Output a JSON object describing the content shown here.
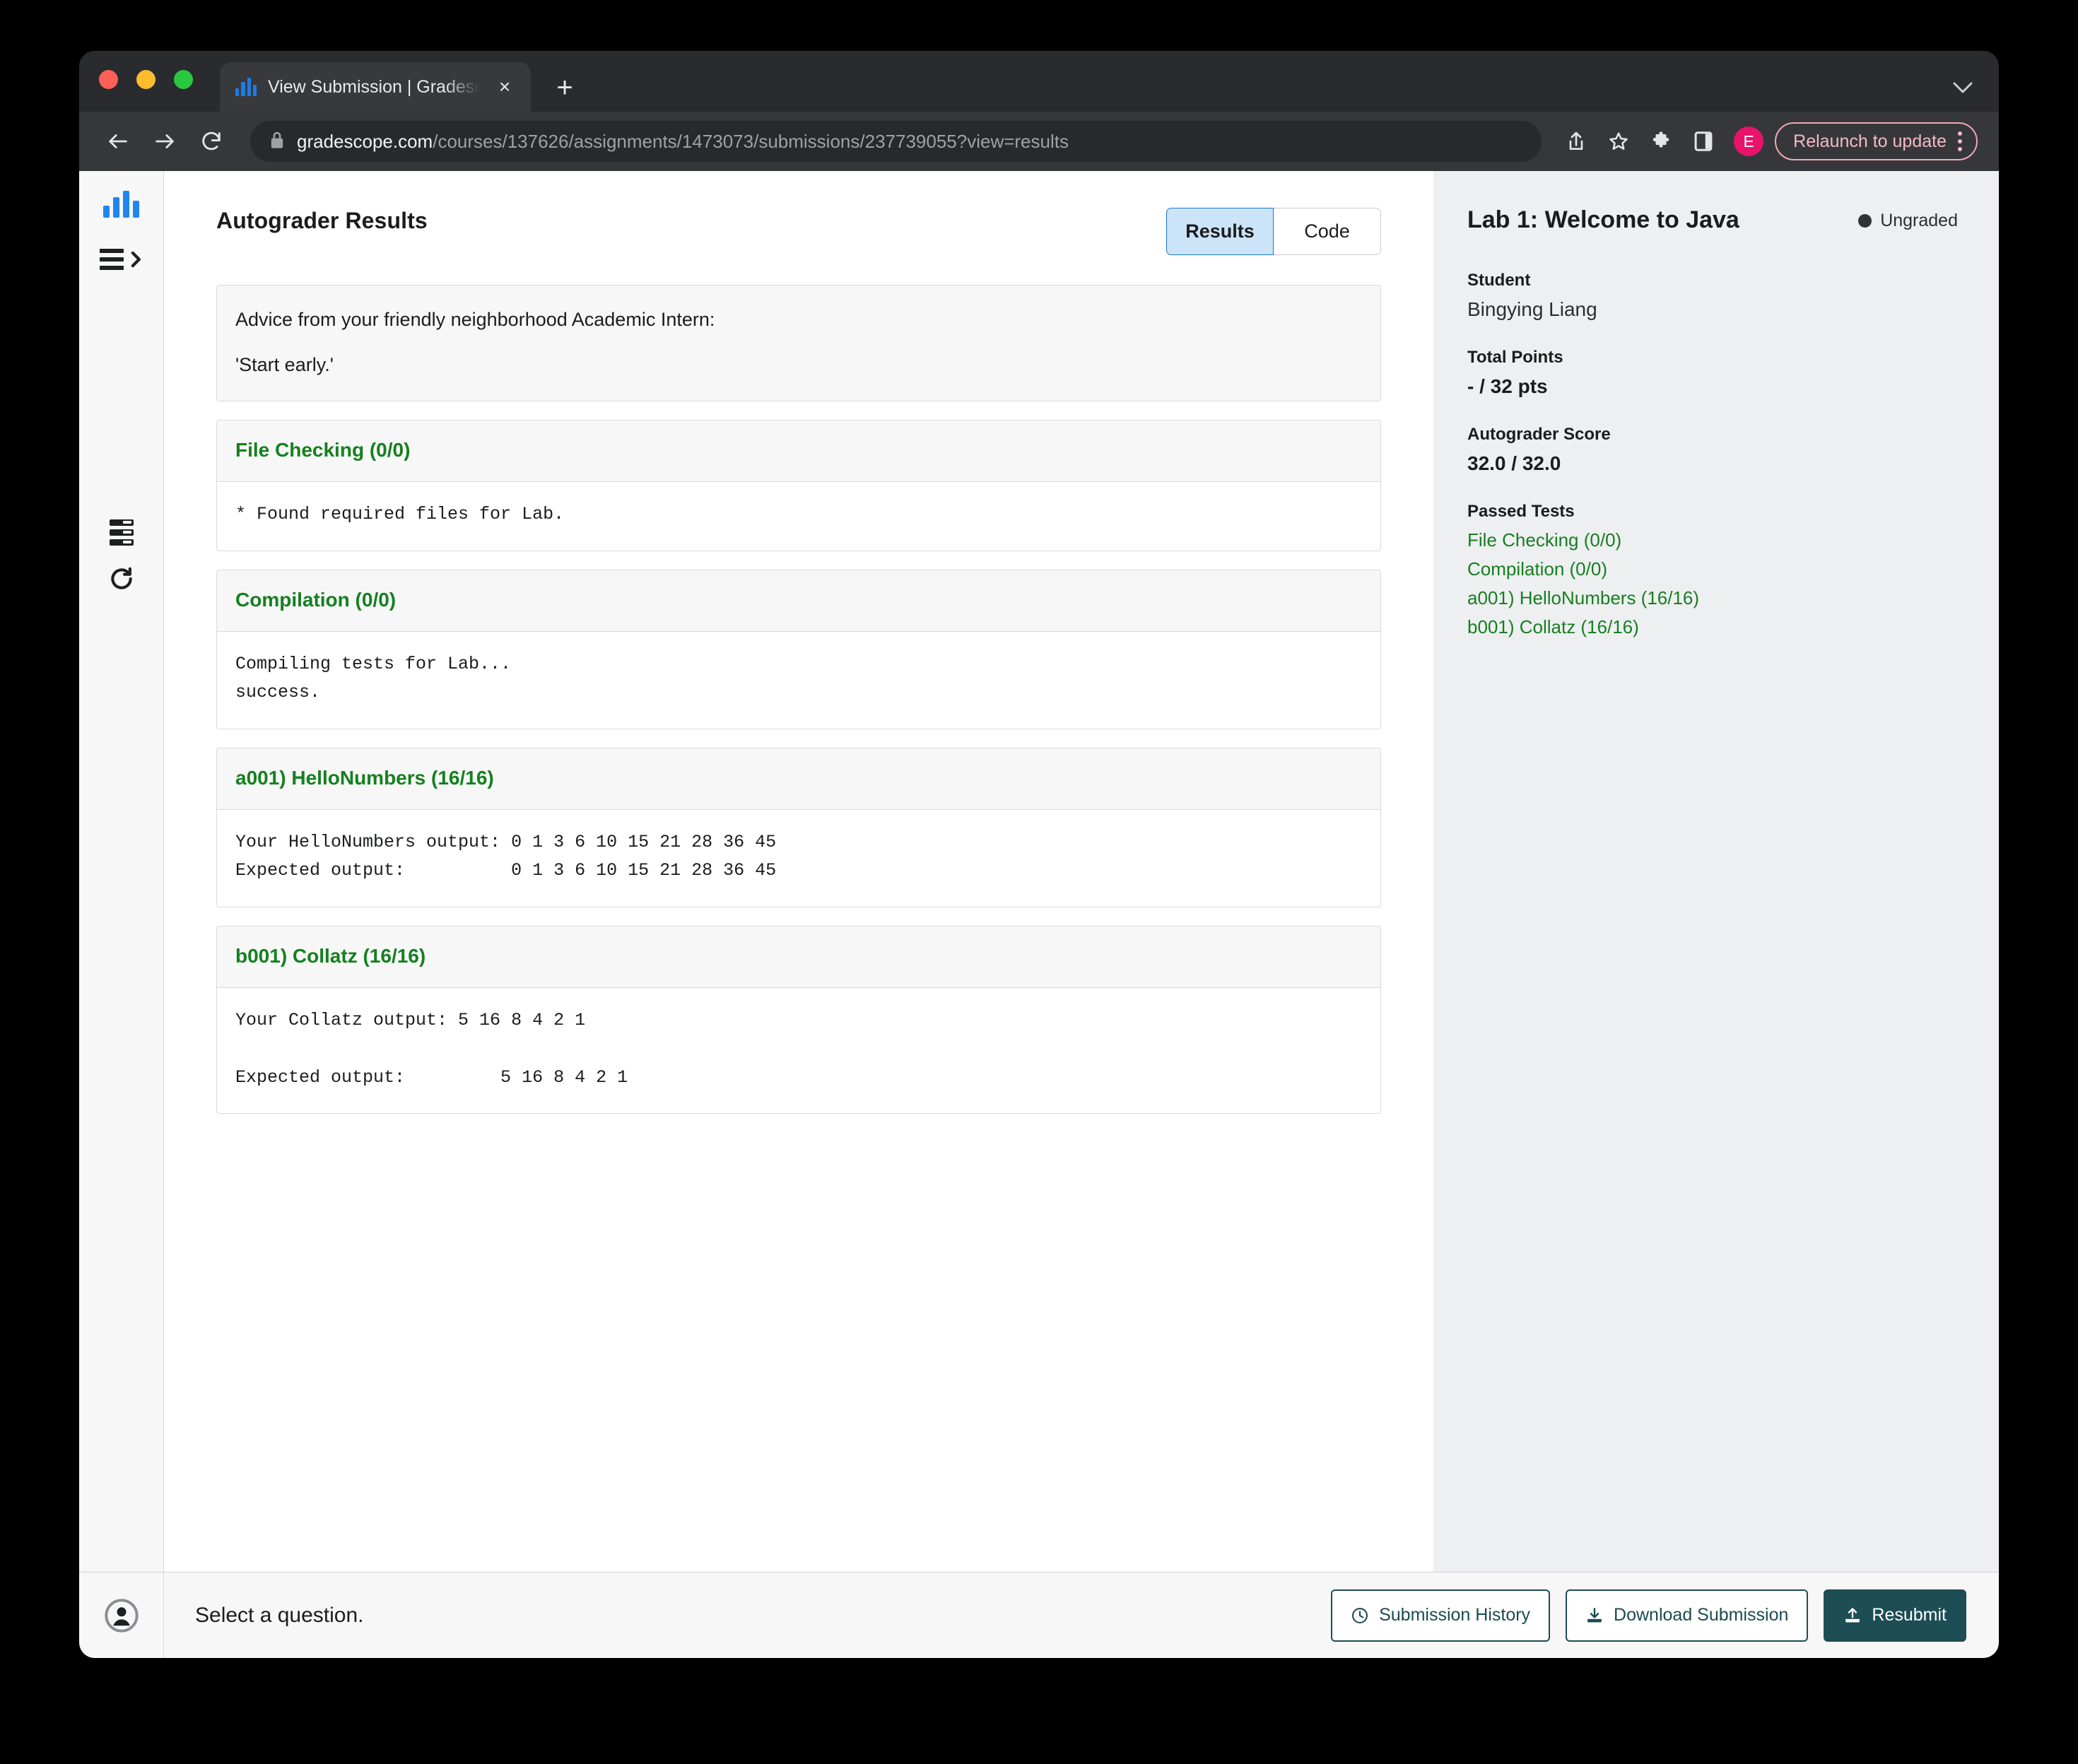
{
  "browser": {
    "tab": {
      "title": "View Submission | Gradescope",
      "favicon": "bar-chart-icon",
      "close": "×"
    },
    "new_tab": "+",
    "url": {
      "host": "gradescope.com",
      "path": "/courses/137626/assignments/1473073/submissions/237739055?view=results"
    },
    "relaunch_label": "Relaunch to update",
    "profile_initial": "E",
    "profile_color": "#e8136a",
    "relaunch_color": "#f7b9c4"
  },
  "rail": {
    "logo": "gradescope-logo-icon",
    "items": [
      {
        "name": "menu-expand-icon"
      },
      {
        "name": "question-list-icon"
      },
      {
        "name": "refresh-icon"
      }
    ]
  },
  "main": {
    "title": "Autograder Results",
    "toggle": {
      "results": "Results",
      "code": "Code",
      "active": "Results"
    },
    "advice": {
      "line1": "Advice from your friendly neighborhood Academic Intern:",
      "line2": "'Start early.'"
    },
    "sections": [
      {
        "name": "File Checking (0/0)",
        "output": "* Found required files for Lab."
      },
      {
        "name": "Compilation (0/0)",
        "output": "Compiling tests for Lab...\nsuccess."
      },
      {
        "name": "a001) HelloNumbers (16/16)",
        "output": "Your HelloNumbers output: 0 1 3 6 10 15 21 28 36 45\nExpected output:          0 1 3 6 10 15 21 28 36 45"
      },
      {
        "name": "b001) Collatz (16/16)",
        "output": "Your Collatz output: 5 16 8 4 2 1\n\nExpected output:         5 16 8 4 2 1"
      }
    ]
  },
  "sidebar": {
    "title": "Lab 1: Welcome to Java",
    "status": "Ungraded",
    "student_label": "Student",
    "student_name": "Bingying Liang",
    "total_points_label": "Total Points",
    "total_points_value": "- / 32 pts",
    "autograder_label": "Autograder Score",
    "autograder_value": "32.0 / 32.0",
    "passed_label": "Passed Tests",
    "passed_tests": [
      "File Checking (0/0)",
      "Compilation (0/0)",
      "a001) HelloNumbers (16/16)",
      "b001) Collatz (16/16)"
    ],
    "link_color": "#167f20"
  },
  "bottom": {
    "message": "Select a question.",
    "submission_history": "Submission History",
    "download_submission": "Download Submission",
    "resubmit": "Resubmit"
  }
}
